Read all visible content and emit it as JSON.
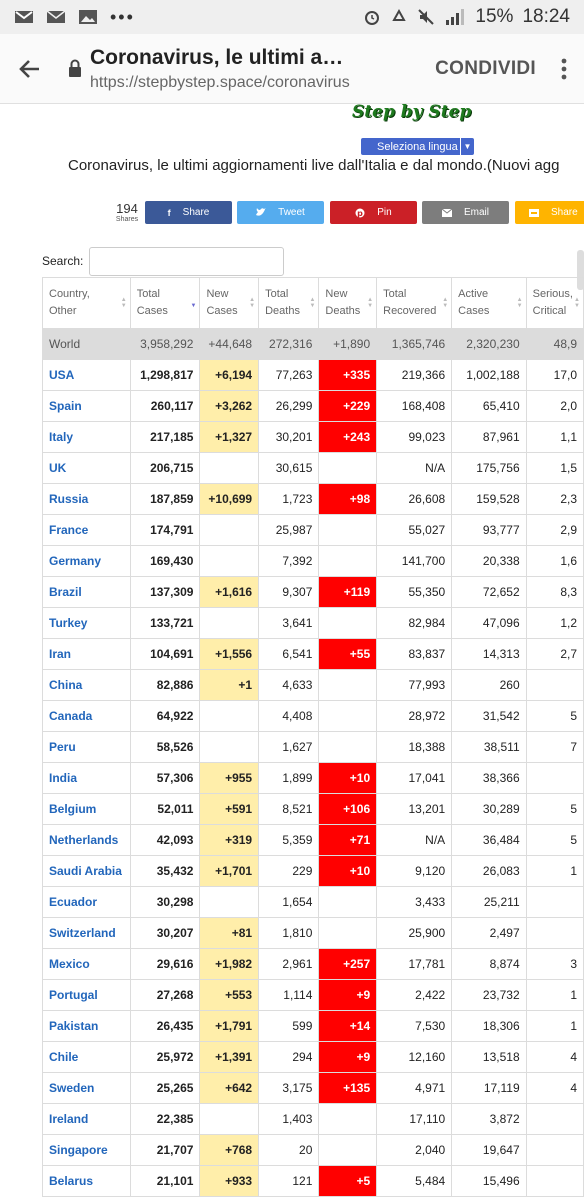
{
  "status_bar": {
    "battery": "15%",
    "time": "18:24"
  },
  "toolbar": {
    "title": "Coronavirus, le ultimi aggiornamenti live dall'Italia e dal mondo",
    "url": "https://stepbystep.space/coronavirus",
    "share_label": "CONDIVIDI"
  },
  "page": {
    "brand": "Step by Step",
    "language_select": "Seleziona lingua",
    "headline": "Coronavirus, le ultimi aggiornamenti live dall'Italia e dal mondo.(Nuovi agg",
    "share_count": "194",
    "share_count_label": "Shares",
    "share_buttons": [
      {
        "label": "Share",
        "icon": "facebook-icon",
        "color": "#3b5998"
      },
      {
        "label": "Tweet",
        "icon": "twitter-icon",
        "color": "#55acee"
      },
      {
        "label": "Pin",
        "icon": "pinterest-icon",
        "color": "#cb2027"
      },
      {
        "label": "Email",
        "icon": "email-icon",
        "color": "#7d7d7d"
      },
      {
        "label": "Share",
        "icon": "share-icon",
        "color": "#ffb400"
      }
    ],
    "search_label": "Search:"
  },
  "table": {
    "headers": [
      {
        "line1": "Country,",
        "line2": "Other"
      },
      {
        "line1": "Total",
        "line2": "Cases"
      },
      {
        "line1": "New",
        "line2": "Cases"
      },
      {
        "line1": "Total",
        "line2": "Deaths"
      },
      {
        "line1": "New",
        "line2": "Deaths"
      },
      {
        "line1": "Total",
        "line2": "Recovered"
      },
      {
        "line1": "Active",
        "line2": "Cases"
      },
      {
        "line1": "Serious,",
        "line2": "Critical"
      }
    ],
    "world": {
      "country": "World",
      "total_cases": "3,958,292",
      "new_cases": "+44,648",
      "total_deaths": "272,316",
      "new_deaths": "+1,890",
      "total_recovered": "1,365,746",
      "active_cases": "2,320,230",
      "serious": "48,9"
    },
    "rows": [
      {
        "country": "USA",
        "total_cases": "1,298,817",
        "new_cases": "+6,194",
        "total_deaths": "77,263",
        "new_deaths": "+335",
        "total_recovered": "219,366",
        "active_cases": "1,002,188",
        "serious": "17,0"
      },
      {
        "country": "Spain",
        "total_cases": "260,117",
        "new_cases": "+3,262",
        "total_deaths": "26,299",
        "new_deaths": "+229",
        "total_recovered": "168,408",
        "active_cases": "65,410",
        "serious": "2,0"
      },
      {
        "country": "Italy",
        "total_cases": "217,185",
        "new_cases": "+1,327",
        "total_deaths": "30,201",
        "new_deaths": "+243",
        "total_recovered": "99,023",
        "active_cases": "87,961",
        "serious": "1,1"
      },
      {
        "country": "UK",
        "total_cases": "206,715",
        "new_cases": "",
        "total_deaths": "30,615",
        "new_deaths": "",
        "total_recovered": "N/A",
        "active_cases": "175,756",
        "serious": "1,5"
      },
      {
        "country": "Russia",
        "total_cases": "187,859",
        "new_cases": "+10,699",
        "total_deaths": "1,723",
        "new_deaths": "+98",
        "total_recovered": "26,608",
        "active_cases": "159,528",
        "serious": "2,3"
      },
      {
        "country": "France",
        "total_cases": "174,791",
        "new_cases": "",
        "total_deaths": "25,987",
        "new_deaths": "",
        "total_recovered": "55,027",
        "active_cases": "93,777",
        "serious": "2,9"
      },
      {
        "country": "Germany",
        "total_cases": "169,430",
        "new_cases": "",
        "total_deaths": "7,392",
        "new_deaths": "",
        "total_recovered": "141,700",
        "active_cases": "20,338",
        "serious": "1,6"
      },
      {
        "country": "Brazil",
        "total_cases": "137,309",
        "new_cases": "+1,616",
        "total_deaths": "9,307",
        "new_deaths": "+119",
        "total_recovered": "55,350",
        "active_cases": "72,652",
        "serious": "8,3"
      },
      {
        "country": "Turkey",
        "total_cases": "133,721",
        "new_cases": "",
        "total_deaths": "3,641",
        "new_deaths": "",
        "total_recovered": "82,984",
        "active_cases": "47,096",
        "serious": "1,2"
      },
      {
        "country": "Iran",
        "total_cases": "104,691",
        "new_cases": "+1,556",
        "total_deaths": "6,541",
        "new_deaths": "+55",
        "total_recovered": "83,837",
        "active_cases": "14,313",
        "serious": "2,7"
      },
      {
        "country": "China",
        "total_cases": "82,886",
        "new_cases": "+1",
        "total_deaths": "4,633",
        "new_deaths": "",
        "total_recovered": "77,993",
        "active_cases": "260",
        "serious": ""
      },
      {
        "country": "Canada",
        "total_cases": "64,922",
        "new_cases": "",
        "total_deaths": "4,408",
        "new_deaths": "",
        "total_recovered": "28,972",
        "active_cases": "31,542",
        "serious": "5"
      },
      {
        "country": "Peru",
        "total_cases": "58,526",
        "new_cases": "",
        "total_deaths": "1,627",
        "new_deaths": "",
        "total_recovered": "18,388",
        "active_cases": "38,511",
        "serious": "7"
      },
      {
        "country": "India",
        "total_cases": "57,306",
        "new_cases": "+955",
        "total_deaths": "1,899",
        "new_deaths": "+10",
        "total_recovered": "17,041",
        "active_cases": "38,366",
        "serious": ""
      },
      {
        "country": "Belgium",
        "total_cases": "52,011",
        "new_cases": "+591",
        "total_deaths": "8,521",
        "new_deaths": "+106",
        "total_recovered": "13,201",
        "active_cases": "30,289",
        "serious": "5"
      },
      {
        "country": "Netherlands",
        "total_cases": "42,093",
        "new_cases": "+319",
        "total_deaths": "5,359",
        "new_deaths": "+71",
        "total_recovered": "N/A",
        "active_cases": "36,484",
        "serious": "5"
      },
      {
        "country": "Saudi Arabia",
        "total_cases": "35,432",
        "new_cases": "+1,701",
        "total_deaths": "229",
        "new_deaths": "+10",
        "total_recovered": "9,120",
        "active_cases": "26,083",
        "serious": "1"
      },
      {
        "country": "Ecuador",
        "total_cases": "30,298",
        "new_cases": "",
        "total_deaths": "1,654",
        "new_deaths": "",
        "total_recovered": "3,433",
        "active_cases": "25,211",
        "serious": ""
      },
      {
        "country": "Switzerland",
        "total_cases": "30,207",
        "new_cases": "+81",
        "total_deaths": "1,810",
        "new_deaths": "",
        "total_recovered": "25,900",
        "active_cases": "2,497",
        "serious": ""
      },
      {
        "country": "Mexico",
        "total_cases": "29,616",
        "new_cases": "+1,982",
        "total_deaths": "2,961",
        "new_deaths": "+257",
        "total_recovered": "17,781",
        "active_cases": "8,874",
        "serious": "3"
      },
      {
        "country": "Portugal",
        "total_cases": "27,268",
        "new_cases": "+553",
        "total_deaths": "1,114",
        "new_deaths": "+9",
        "total_recovered": "2,422",
        "active_cases": "23,732",
        "serious": "1"
      },
      {
        "country": "Pakistan",
        "total_cases": "26,435",
        "new_cases": "+1,791",
        "total_deaths": "599",
        "new_deaths": "+14",
        "total_recovered": "7,530",
        "active_cases": "18,306",
        "serious": "1"
      },
      {
        "country": "Chile",
        "total_cases": "25,972",
        "new_cases": "+1,391",
        "total_deaths": "294",
        "new_deaths": "+9",
        "total_recovered": "12,160",
        "active_cases": "13,518",
        "serious": "4"
      },
      {
        "country": "Sweden",
        "total_cases": "25,265",
        "new_cases": "+642",
        "total_deaths": "3,175",
        "new_deaths": "+135",
        "total_recovered": "4,971",
        "active_cases": "17,119",
        "serious": "4"
      },
      {
        "country": "Ireland",
        "total_cases": "22,385",
        "new_cases": "",
        "total_deaths": "1,403",
        "new_deaths": "",
        "total_recovered": "17,110",
        "active_cases": "3,872",
        "serious": ""
      },
      {
        "country": "Singapore",
        "total_cases": "21,707",
        "new_cases": "+768",
        "total_deaths": "20",
        "new_deaths": "",
        "total_recovered": "2,040",
        "active_cases": "19,647",
        "serious": ""
      },
      {
        "country": "Belarus",
        "total_cases": "21,101",
        "new_cases": "+933",
        "total_deaths": "121",
        "new_deaths": "+5",
        "total_recovered": "5,484",
        "active_cases": "15,496",
        "serious": ""
      }
    ]
  }
}
